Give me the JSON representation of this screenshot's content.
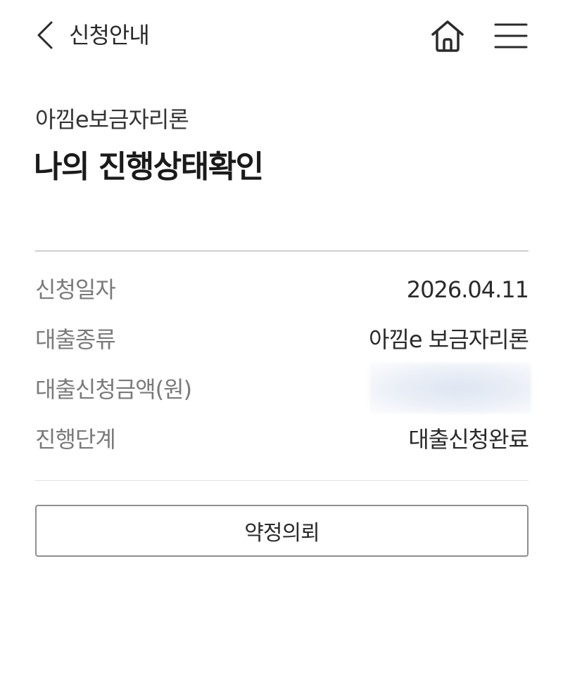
{
  "header": {
    "back_icon": "chevron-left-icon",
    "title": "신청안내",
    "home_icon": "home-icon",
    "menu_icon": "hamburger-menu-icon"
  },
  "subtitle": "아낌e보금자리론",
  "page_title": "나의 진행상태확인",
  "info": {
    "rows": [
      {
        "label": "신청일자",
        "value": "2026.04.11"
      },
      {
        "label": "대출종류",
        "value": "아낌e 보금자리론"
      },
      {
        "label": "대출신청금액(원)",
        "value": ""
      },
      {
        "label": "진행단계",
        "value": "대출신청완료"
      }
    ]
  },
  "action": {
    "label": "약정의뢰"
  },
  "colors": {
    "text_primary": "#1a1a1a",
    "text_label": "#7a7a7a",
    "divider": "#cfcfcf",
    "button_border": "#8f8f8f"
  }
}
